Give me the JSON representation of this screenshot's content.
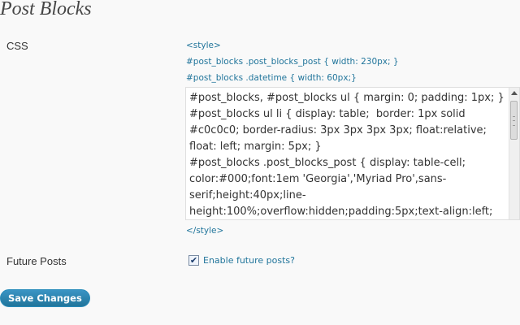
{
  "page": {
    "title": "Post Blocks"
  },
  "css_row": {
    "label": "CSS",
    "style_open": "<style>",
    "code_lines": [
      "#post_blocks .post_blocks_post { width: 230px; }",
      "#post_blocks .datetime { width: 60px;}"
    ],
    "textarea_value": "#post_blocks, #post_blocks ul { margin: 0; padding: 1px; }\n#post_blocks ul li { display: table;  border: 1px solid #c0c0c0; border-radius: 3px 3px 3px 3px; float:relative; float: left; margin: 5px; }\n#post_blocks .post_blocks_post { display: table-cell; color:#000;font:1em 'Georgia','Myriad Pro',sans-serif;height:40px;line-height:100%;overflow:hidden;padding:5px;text-align:left;",
    "style_close": "</style>"
  },
  "future_row": {
    "label": "Future Posts",
    "checkbox_label": "Enable future posts?",
    "checked": true,
    "check_mark": "✔"
  },
  "actions": {
    "save_label": "Save Changes"
  },
  "colors": {
    "link_blue": "#21759b",
    "button_blue": "#21759b"
  }
}
